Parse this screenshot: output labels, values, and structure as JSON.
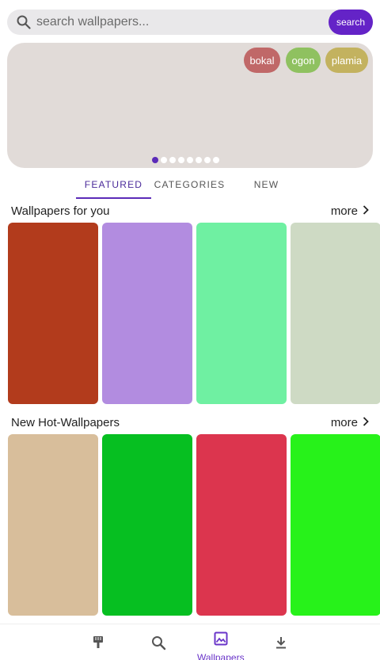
{
  "search": {
    "placeholder": "search wallpapers...",
    "button_label": "search"
  },
  "banner": {
    "background": "#e1dbd8",
    "tags": [
      {
        "label": "bokal",
        "color": "#c06868"
      },
      {
        "label": "ogon",
        "color": "#8fc160"
      },
      {
        "label": "plamia",
        "color": "#c3b25f"
      }
    ],
    "page_count": 8,
    "active_page": 1
  },
  "tabs": [
    {
      "label": "FEATURED",
      "active": true
    },
    {
      "label": "CATEGORIES",
      "active": false
    },
    {
      "label": "NEW",
      "active": false
    }
  ],
  "sections": [
    {
      "title": "Wallpapers for you",
      "more_label": "more",
      "cards": [
        "#b23b1c",
        "#b28ce0",
        "#6ff0a2",
        "#cedac4"
      ]
    },
    {
      "title": "New Hot-Wallpapers",
      "more_label": "more",
      "cards": [
        "#d8be9b",
        "#06bf21",
        "#dc354e",
        "#27f21a"
      ]
    }
  ],
  "bottom_nav": {
    "items": [
      {
        "icon": "brush-icon",
        "label": ""
      },
      {
        "icon": "search-icon",
        "label": ""
      },
      {
        "icon": "wallpapers-icon",
        "label": "Wallpapers",
        "active": true
      },
      {
        "icon": "download-icon",
        "label": ""
      }
    ]
  },
  "colors": {
    "accent": "#6423c7",
    "active_tab": "#5b2bb8"
  }
}
